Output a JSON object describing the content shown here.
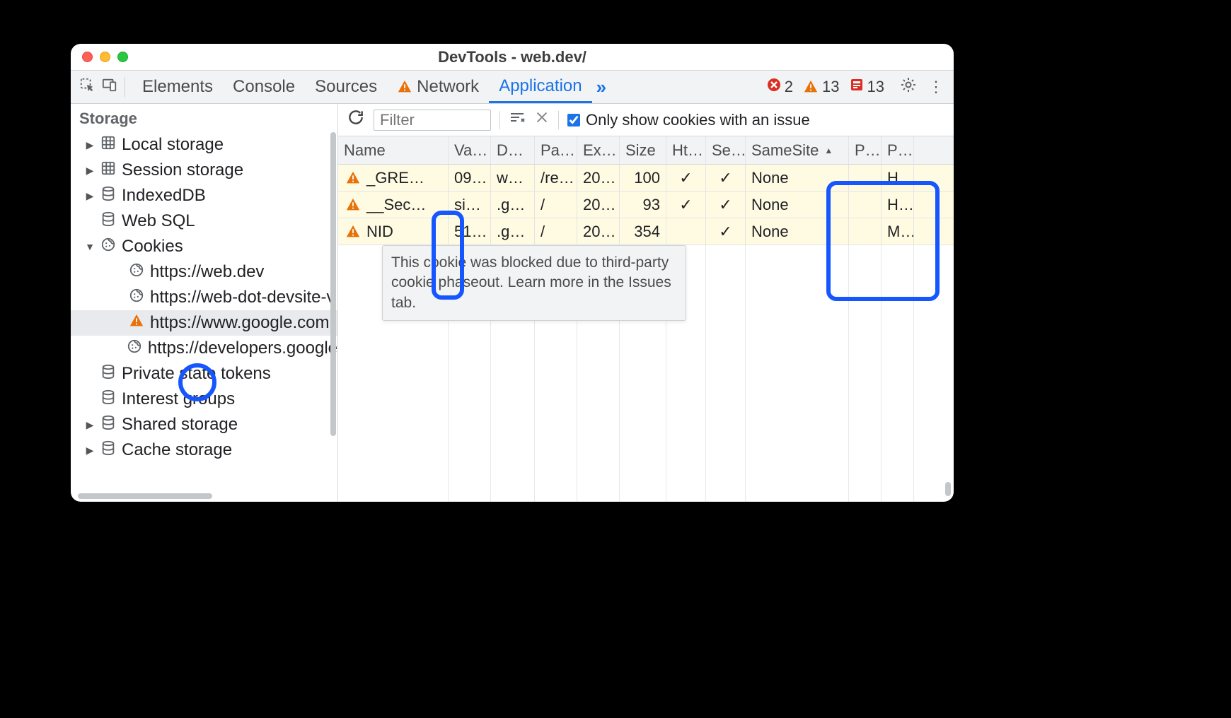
{
  "window": {
    "title": "DevTools - web.dev/"
  },
  "tabs": {
    "items": [
      "Elements",
      "Console",
      "Sources",
      "Network",
      "Application"
    ],
    "active": 4,
    "network_has_warning": true,
    "more": "»"
  },
  "statusCounts": {
    "errors": "2",
    "warnings": "13",
    "issues": "13"
  },
  "sidebar": {
    "section": "Storage",
    "nodes": [
      {
        "label": "Local storage",
        "icon": "grid",
        "caret": "▶",
        "depth": 0
      },
      {
        "label": "Session storage",
        "icon": "grid",
        "caret": "▶",
        "depth": 0
      },
      {
        "label": "IndexedDB",
        "icon": "db",
        "caret": "▶",
        "depth": 0
      },
      {
        "label": "Web SQL",
        "icon": "db",
        "caret": "",
        "depth": 0
      },
      {
        "label": "Cookies",
        "icon": "cookie",
        "caret": "▼",
        "depth": 0
      },
      {
        "label": "https://web.dev",
        "icon": "cookie",
        "caret": "",
        "depth": 1
      },
      {
        "label": "https://web-dot-devsite-v",
        "icon": "cookie",
        "caret": "",
        "depth": 1
      },
      {
        "label": "https://www.google.com",
        "icon": "warn",
        "caret": "",
        "depth": 1,
        "selected": true
      },
      {
        "label": "https://developers.google",
        "icon": "cookie",
        "caret": "",
        "depth": 1
      },
      {
        "label": "Private state tokens",
        "icon": "db",
        "caret": "",
        "depth": 0
      },
      {
        "label": "Interest groups",
        "icon": "db",
        "caret": "",
        "depth": 0
      },
      {
        "label": "Shared storage",
        "icon": "db",
        "caret": "▶",
        "depth": 0
      },
      {
        "label": "Cache storage",
        "icon": "db",
        "caret": "▶",
        "depth": 0
      }
    ]
  },
  "toolbar": {
    "filter_placeholder": "Filter",
    "only_issue_label": "Only show cookies with an issue",
    "only_issue_checked": true
  },
  "table": {
    "columns": [
      "Name",
      "Va…",
      "D…",
      "Pa…",
      "Ex…",
      "Size",
      "Ht…",
      "Se…",
      "SameSite",
      "P…",
      "P…"
    ],
    "sorted_column": 8,
    "rows": [
      {
        "name": "_GRE…",
        "value": "09…",
        "domain": "w…",
        "path": "/re…",
        "expires": "20…",
        "size": "100",
        "http": "✓",
        "secure": "✓",
        "samesite": "None",
        "partition": "",
        "priority": "H…"
      },
      {
        "name": "__Sec…",
        "value": "si…",
        "domain": ".g…",
        "path": "/",
        "expires": "20…",
        "size": "93",
        "http": "✓",
        "secure": "✓",
        "samesite": "None",
        "partition": "",
        "priority": "H…"
      },
      {
        "name": "NID",
        "value": "51…",
        "domain": ".g…",
        "path": "/",
        "expires": "20…",
        "size": "354",
        "http": "",
        "secure": "✓",
        "samesite": "None",
        "partition": "",
        "priority": "M…"
      }
    ]
  },
  "tooltip": "This cookie was blocked due to third-party cookie phaseout. Learn more in the Issues tab."
}
